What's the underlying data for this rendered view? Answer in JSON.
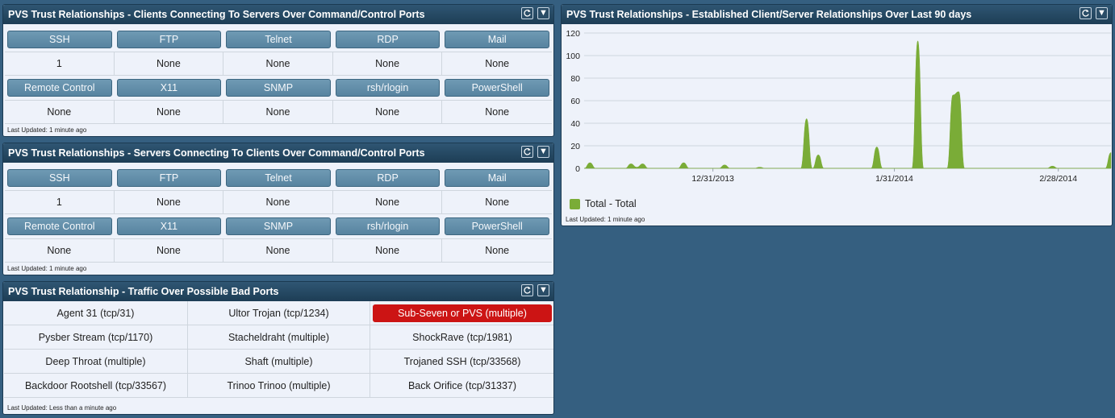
{
  "colors": {
    "page_bg": "#355f80",
    "header_bg": "#1d3d55",
    "button_bg": "#5f8aa6",
    "alert": "#cc1414",
    "series": "#7aac37"
  },
  "widget1": {
    "title": "PVS Trust Relationships - Clients Connecting To Servers Over Command/Control Ports",
    "rows": [
      {
        "labels": [
          "SSH",
          "FTP",
          "Telnet",
          "RDP",
          "Mail"
        ],
        "values": [
          "1",
          "None",
          "None",
          "None",
          "None"
        ]
      },
      {
        "labels": [
          "Remote Control",
          "X11",
          "SNMP",
          "rsh/rlogin",
          "PowerShell"
        ],
        "values": [
          "None",
          "None",
          "None",
          "None",
          "None"
        ]
      }
    ],
    "footer": "Last Updated: 1 minute ago"
  },
  "widget2": {
    "title": "PVS Trust Relationships - Servers Connecting To Clients Over Command/Control Ports",
    "rows": [
      {
        "labels": [
          "SSH",
          "FTP",
          "Telnet",
          "RDP",
          "Mail"
        ],
        "values": [
          "1",
          "None",
          "None",
          "None",
          "None"
        ]
      },
      {
        "labels": [
          "Remote Control",
          "X11",
          "SNMP",
          "rsh/rlogin",
          "PowerShell"
        ],
        "values": [
          "None",
          "None",
          "None",
          "None",
          "None"
        ]
      }
    ],
    "footer": "Last Updated: 1 minute ago"
  },
  "widget3": {
    "title": "PVS Trust Relationship - Traffic Over Possible Bad Ports",
    "items": [
      {
        "label": "Agent 31 (tcp/31)",
        "alert": false
      },
      {
        "label": "Ultor Trojan (tcp/1234)",
        "alert": false
      },
      {
        "label": "Sub-Seven or PVS (multiple)",
        "alert": true
      },
      {
        "label": "Pysber Stream (tcp/1170)",
        "alert": false
      },
      {
        "label": "Stacheldraht (multiple)",
        "alert": false
      },
      {
        "label": "ShockRave (tcp/1981)",
        "alert": false
      },
      {
        "label": "Deep Throat (multiple)",
        "alert": false
      },
      {
        "label": "Shaft (multiple)",
        "alert": false
      },
      {
        "label": "Trojaned SSH (tcp/33568)",
        "alert": false
      },
      {
        "label": "Backdoor Rootshell (tcp/33567)",
        "alert": false
      },
      {
        "label": "Trinoo Trinoo (multiple)",
        "alert": false
      },
      {
        "label": "Back Orifice (tcp/31337)",
        "alert": false
      }
    ],
    "footer": "Last Updated: Less than a minute ago"
  },
  "widget4": {
    "title": "PVS Trust Relationships - Established Client/Server Relationships Over Last 90 days",
    "footer": "Last Updated: 1 minute ago",
    "legend": "Total - Total"
  },
  "icons": {
    "refresh": "refresh-icon",
    "menu": "dropdown-arrow-icon"
  },
  "chart_data": {
    "type": "area",
    "title": "",
    "xlabel": "",
    "ylabel": "",
    "ylim": [
      0,
      120
    ],
    "yticks": [
      0,
      20,
      40,
      60,
      80,
      100,
      120
    ],
    "xlim": [
      "2013-12-09",
      "2014-03-09"
    ],
    "xticks": [
      {
        "date": "2013-12-31",
        "label": "12/31/2013"
      },
      {
        "date": "2014-01-31",
        "label": "1/31/2014"
      },
      {
        "date": "2014-02-28",
        "label": "2/28/2014"
      }
    ],
    "grid": true,
    "legend_position": "bottom-left",
    "series": [
      {
        "name": "Total - Total",
        "color": "#7aac37",
        "points": [
          [
            "2013-12-09",
            0
          ],
          [
            "2013-12-10",
            5
          ],
          [
            "2013-12-11",
            0
          ],
          [
            "2013-12-16",
            0
          ],
          [
            "2013-12-17",
            4
          ],
          [
            "2013-12-18",
            1
          ],
          [
            "2013-12-19",
            4
          ],
          [
            "2013-12-20",
            0
          ],
          [
            "2013-12-25",
            0
          ],
          [
            "2013-12-26",
            5
          ],
          [
            "2013-12-27",
            0
          ],
          [
            "2014-01-01",
            0
          ],
          [
            "2014-01-02",
            3
          ],
          [
            "2014-01-03",
            0
          ],
          [
            "2014-01-07",
            0
          ],
          [
            "2014-01-08",
            1
          ],
          [
            "2014-01-09",
            0
          ],
          [
            "2014-01-15",
            0
          ],
          [
            "2014-01-16",
            44
          ],
          [
            "2014-01-17",
            0
          ],
          [
            "2014-01-18",
            12
          ],
          [
            "2014-01-19",
            0
          ],
          [
            "2014-01-27",
            0
          ],
          [
            "2014-01-28",
            19
          ],
          [
            "2014-01-29",
            0
          ],
          [
            "2014-02-03",
            0
          ],
          [
            "2014-02-04",
            113
          ],
          [
            "2014-02-05",
            0
          ],
          [
            "2014-02-09",
            0
          ],
          [
            "2014-02-10",
            65
          ],
          [
            "2014-02-11",
            68
          ],
          [
            "2014-02-12",
            0
          ],
          [
            "2014-02-26",
            0
          ],
          [
            "2014-02-27",
            2
          ],
          [
            "2014-02-28",
            0
          ],
          [
            "2014-03-08",
            0
          ],
          [
            "2014-03-09",
            14
          ]
        ]
      }
    ]
  }
}
